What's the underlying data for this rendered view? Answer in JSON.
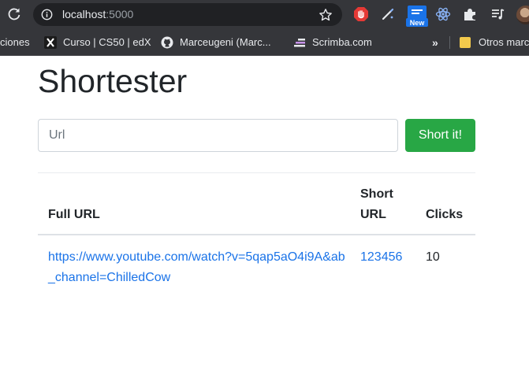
{
  "browser": {
    "address": {
      "host": "localhost",
      "port": ":5000"
    },
    "extensions": {
      "new_badge": "New"
    },
    "bookmarks": {
      "apps_partial": "ciones",
      "cs50": "Curso | CS50 | edX",
      "github": "Marceugeni (Marc...",
      "scrimba": "Scrimba.com",
      "more": "»",
      "otros": "Otros marc"
    }
  },
  "page": {
    "title": "Shortester",
    "form": {
      "url_placeholder": "Url",
      "url_value": "",
      "submit_label": "Short it!"
    },
    "table": {
      "headers": {
        "full_url": "Full URL",
        "short_url": "Short URL",
        "clicks": "Clicks"
      },
      "rows": [
        {
          "full_url": "https://www.youtube.com/watch?v=5qap5aO4i9A&ab_channel=ChilledCow",
          "short_url": "123456",
          "clicks": "10"
        }
      ]
    }
  },
  "colors": {
    "chrome_bg": "#35363a",
    "omnibox_bg": "#202124",
    "button_green": "#28a745",
    "link_blue": "#1a73e8",
    "text_dark": "#212529"
  }
}
